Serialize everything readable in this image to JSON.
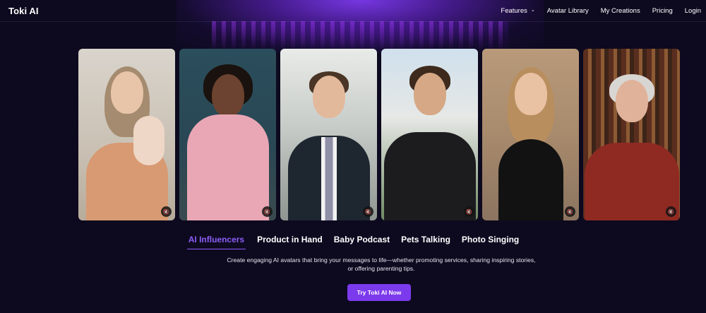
{
  "header": {
    "logo": "Toki AI",
    "nav": [
      {
        "label": "Features",
        "has_dropdown": true
      },
      {
        "label": "Avatar Library"
      },
      {
        "label": "My Creations"
      },
      {
        "label": "Pricing"
      },
      {
        "label": "Login"
      }
    ]
  },
  "avatars": [
    {
      "scene": "mother holding baby in living room",
      "mute_icon": "speaker-muted-icon"
    },
    {
      "scene": "woman in pink robe",
      "mute_icon": "speaker-muted-icon"
    },
    {
      "scene": "man in suit in office",
      "mute_icon": "speaker-muted-icon"
    },
    {
      "scene": "man in black hoodie outdoors",
      "mute_icon": "speaker-muted-icon"
    },
    {
      "scene": "woman in black top",
      "mute_icon": "speaker-muted-icon"
    },
    {
      "scene": "older man in library",
      "mute_icon": "speaker-muted-icon"
    }
  ],
  "tabs": [
    {
      "label": "AI Influencers",
      "active": true
    },
    {
      "label": "Product in Hand"
    },
    {
      "label": "Baby Podcast"
    },
    {
      "label": "Pets Talking"
    },
    {
      "label": "Photo Singing"
    }
  ],
  "description": "Create engaging AI avatars that bring your messages to life—whether promoting services, sharing inspiring stories, or offering parenting tips.",
  "cta_label": "Try Toki AI Now",
  "colors": {
    "accent": "#7c3aed",
    "active_tab": "#8b5cf6",
    "background": "#0d0a1f"
  }
}
